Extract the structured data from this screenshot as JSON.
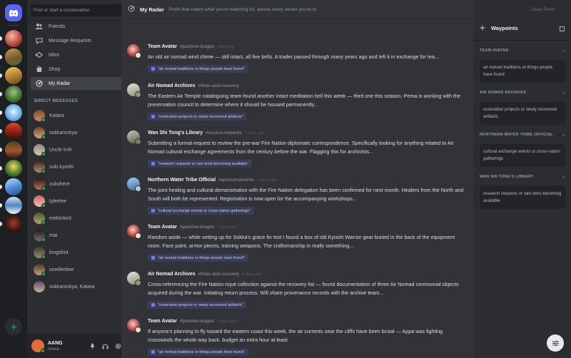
{
  "sidebar": {
    "search_placeholder": "Find or start a conversation",
    "nav": [
      {
        "label": "Friends"
      },
      {
        "label": "Message Requests"
      },
      {
        "label": "Nitro"
      },
      {
        "label": "Shop"
      },
      {
        "label": "My Radar"
      }
    ],
    "dm_header": "DIRECT MESSAGES",
    "dm_add": "+",
    "dms": [
      {
        "name": "Katara"
      },
      {
        "name": "sokkarockya"
      },
      {
        "name": "Uncle Iroh"
      },
      {
        "name": "suki.kyoshi"
      },
      {
        "name": "zukohere"
      },
      {
        "name": "tyleelee"
      },
      {
        "name": "melonlord"
      },
      {
        "name": "mai"
      },
      {
        "name": "longshot"
      },
      {
        "name": "smellerbee"
      },
      {
        "name": "sokkarockya, Katara"
      }
    ]
  },
  "user": {
    "name": "AANG",
    "status": "Online"
  },
  "header": {
    "title": "My Radar",
    "subtitle": "Posts that match what you're watching for, across every server you're in.",
    "clear_label": "Clear Feed"
  },
  "messages": [
    {
      "author": "Team Avatar",
      "channel": "#jasmine-dragon",
      "time": "yesterday",
      "text": "An old air nomad wind chime — still intact, all five bells. A trader passed through many years ago and left it in exchange for tea...",
      "tag": "\"air nomad traditions or things people have found\""
    },
    {
      "author": "Air Nomad Archives",
      "channel": "#finds-and-recovery",
      "time": "",
      "text": "The Eastern Air Temple cataloguing team found another intact meditation bell this week — third one this season. Pema is working with the preservation council to determine where it should be housed permanently...",
      "tag": "\"restoration projects or newly recovered artifacts\""
    },
    {
      "author": "Wan Shi Tong's Library",
      "channel": "#access-requests",
      "time": "2 days ago",
      "text": "Submitting a formal request to review the pre-war Fire Nation diplomatic correspondence. Specifically looking for anything related to Air Nomad cultural exchange agreements from the century before the war. Flagging this for archivists...",
      "tag": "\"research requests or rare texts becoming available\""
    },
    {
      "author": "Northern Water Tribe Official",
      "channel": "#announcements",
      "time": "3 days ago",
      "text": "The joint healing and cultural demonstration with the Fire Nation delegation has been confirmed for next month. Healers from the North and South will both be represented. Registration is now open for the accompanying workshops...",
      "tag": "\"cultural exchange events or cross-nation gatherings\""
    },
    {
      "author": "Team Avatar",
      "channel": "#jasmine-dragon",
      "time": "3 days ago",
      "text": "Random aside — while setting up for Sokka's grace fin test I found a box of old Kyoshi Warrior gear buried in the back of the equipment room. Face paint, armor pieces, training weapons. The craftsmanship is really something...",
      "tag": "\"air nomad traditions or things people have found\""
    },
    {
      "author": "Air Nomad Archives",
      "channel": "#finds-and-recovery",
      "time": "4 days ago",
      "text": "Cross-referencing the Fire Nation royal collection against the recovery list — found documentation of three Air Nomad ceremonial objects acquired during the war. Initiating return process. Will share provenance records with the archive team...",
      "tag": "\"restoration projects or newly recovered artifacts\""
    },
    {
      "author": "Team Avatar",
      "channel": "#jasmine-dragon",
      "time": "5 days ago",
      "text": "If anyone's planning to fly toward the eastern coast this week, the air currents near the cliffs have been brutal — Appa was fighting crosswinds the whole way back. budget an extra hour at least",
      "tag": "\"air nomad traditions or things people have found\""
    }
  ],
  "waypoints": {
    "title": "Waypoints",
    "groups": [
      {
        "header": "TEAM AVATAR",
        "item": "air nomad traditions or things people have found"
      },
      {
        "header": "AIR NOMAD ARCHIVES",
        "item": "restoration projects or newly recovered artifacts"
      },
      {
        "header": "NORTHERN WATER TRIBE OFFICIAL",
        "item": "cultural exchange events or cross-nation gatherings"
      },
      {
        "header": "WAN SHI TONG'S LIBRARY",
        "item": "research requests or rare texts becoming available"
      }
    ]
  },
  "colors": {
    "accent": "#5865f2",
    "online": "#23a559",
    "tag_bg": "#3b3d52"
  }
}
